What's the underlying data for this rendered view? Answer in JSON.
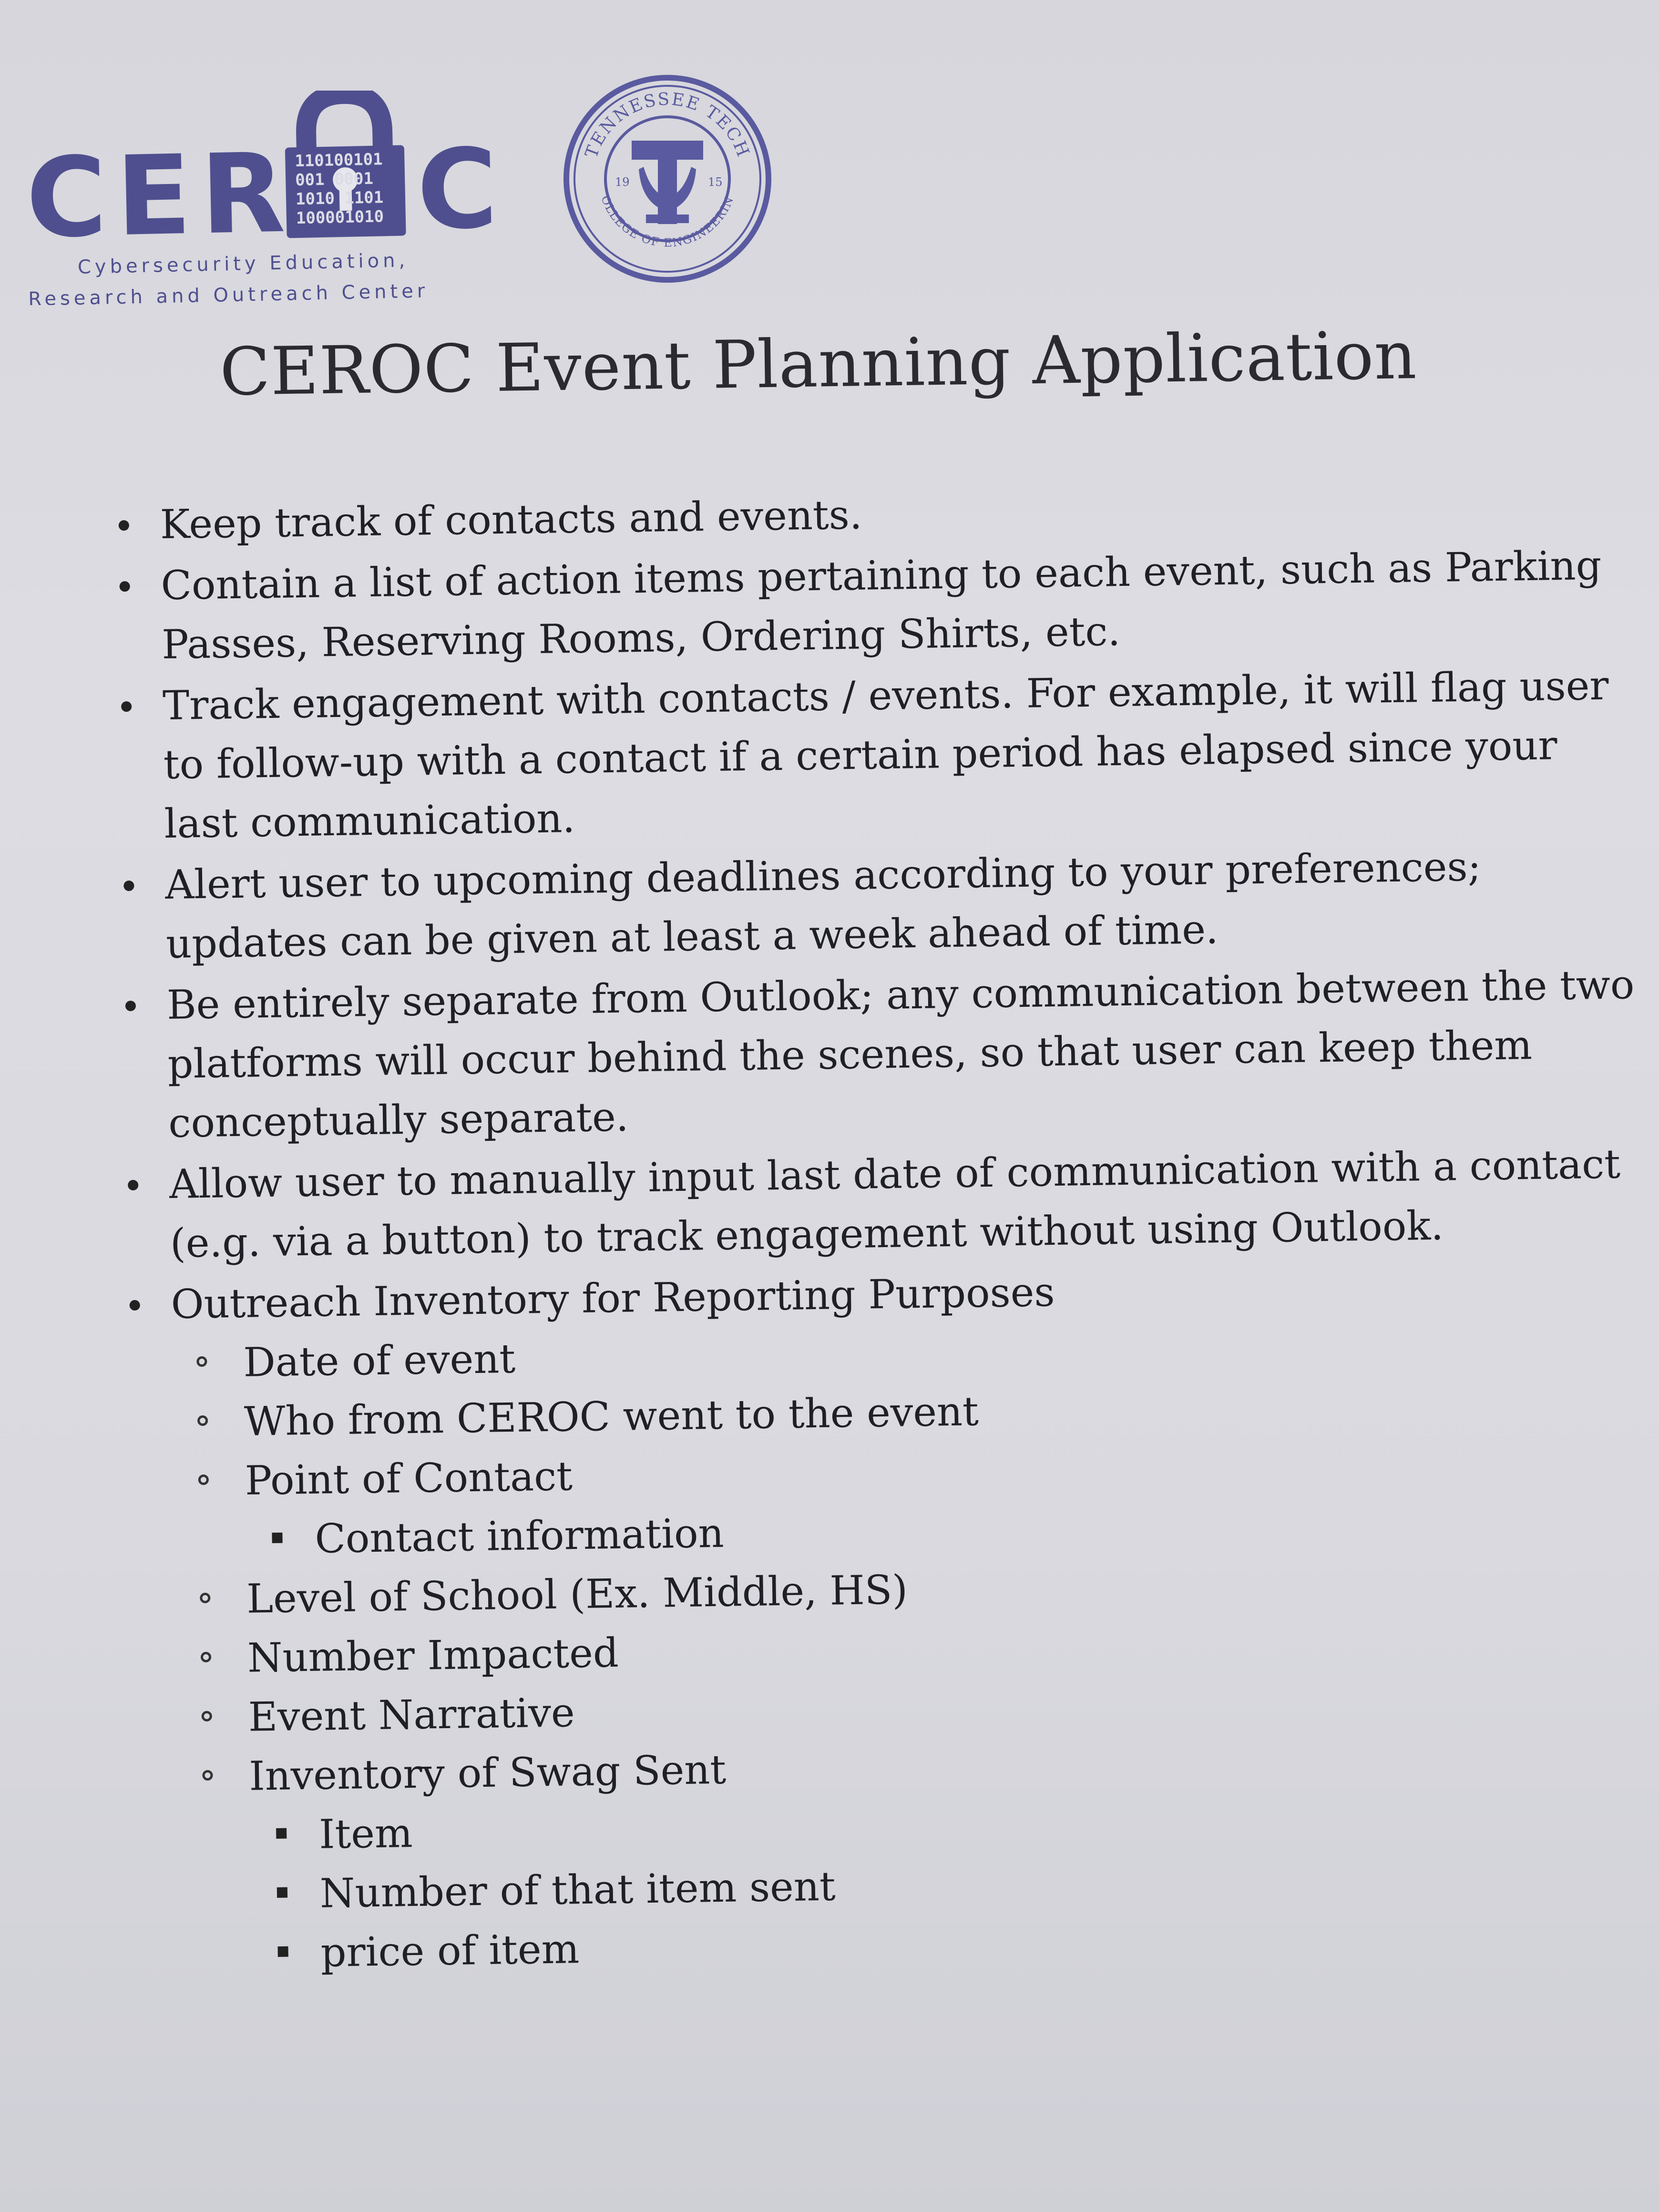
{
  "header": {
    "ceroc_logo": {
      "wordmark_left": "CER",
      "wordmark_right": "C",
      "lock_binary": [
        "110100101",
        "001 0001",
        "1010 1101",
        "100001010"
      ],
      "tagline_line1": "Cybersecurity Education,",
      "tagline_line2": "Research and Outreach Center",
      "color": "#4f4f8f"
    },
    "seal": {
      "top_text": "TENNESSEE TECH",
      "bottom_text": "COLLEGE OF ENGINEERING",
      "year_left": "19",
      "year_right": "15",
      "color": "#5a5aa0"
    }
  },
  "title": "CEROC Event Planning Application",
  "bullets": [
    {
      "text": "Keep track of contacts and events."
    },
    {
      "text": "Contain a list of action items pertaining to each event, such as Parking Passes, Reserving Rooms, Ordering Shirts, etc."
    },
    {
      "text": "Track engagement with contacts / events. For example, it will flag user to follow-up with a contact if a certain period has elapsed since your last communication."
    },
    {
      "text": "Alert user to upcoming deadlines according to your preferences; updates can be given at least a week ahead of time."
    },
    {
      "text": "Be entirely separate from Outlook; any communication between the two platforms will occur behind the scenes, so that user can keep them conceptually separate."
    },
    {
      "text": "Allow user to manually input last date of communication with a contact (e.g. via a button) to track engagement without using Outlook."
    },
    {
      "text": "Outreach Inventory for Reporting Purposes"
    }
  ],
  "inventory": {
    "date": "Date of event",
    "who": "Who from CEROC went to the event",
    "poc": "Point of Contact",
    "poc_sub": "Contact information",
    "level": "Level of School (Ex. Middle, HS)",
    "impacted": "Number Impacted",
    "narrative": "Event Narrative",
    "swag": "Inventory of Swag Sent",
    "swag_sub": [
      "Item",
      "Number of that item sent",
      "price of item"
    ]
  }
}
